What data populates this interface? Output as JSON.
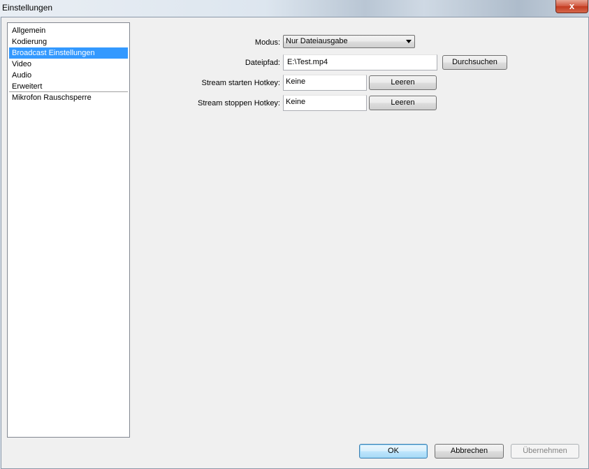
{
  "window": {
    "title": "Einstellungen",
    "close_glyph": "x"
  },
  "sidebar": {
    "items": [
      {
        "label": "Allgemein"
      },
      {
        "label": "Kodierung"
      },
      {
        "label": "Broadcast Einstellungen",
        "selected": true
      },
      {
        "label": "Video"
      },
      {
        "label": "Audio"
      },
      {
        "label": "Erweitert"
      },
      {
        "label": "Mikrofon Rauschsperre"
      }
    ]
  },
  "form": {
    "mode_label": "Modus:",
    "mode_value": "Nur Dateiausgabe",
    "filepath_label": "Dateipfad:",
    "filepath_value": "E:\\Test.mp4",
    "browse_label": "Durchsuchen",
    "start_hotkey_label": "Stream starten Hotkey:",
    "start_hotkey_value": "Keine",
    "stop_hotkey_label": "Stream stoppen Hotkey:",
    "stop_hotkey_value": "Keine",
    "clear_label": "Leeren"
  },
  "footer": {
    "ok_label": "OK",
    "cancel_label": "Abbrechen",
    "apply_label": "Übernehmen"
  },
  "colors": {
    "selection": "#3399ff",
    "window_bg": "#f0f0f0"
  }
}
